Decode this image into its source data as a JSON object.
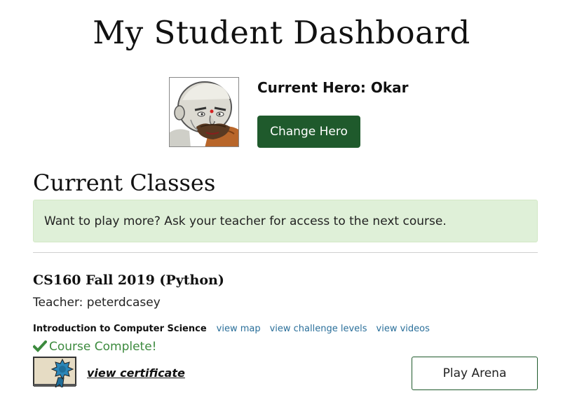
{
  "page": {
    "title": "My Student Dashboard"
  },
  "hero": {
    "label": "Current Hero: Okar",
    "change_button": "Change Hero",
    "portrait_icon": "bald-warrior-portrait"
  },
  "classes": {
    "heading": "Current Classes",
    "notice": "Want to play more? Ask your teacher for access to the next course.",
    "items": [
      {
        "name": "CS160 Fall 2019 (Python)",
        "teacher": "Teacher: peterdcasey",
        "course": {
          "title": "Introduction to Computer Science",
          "links": [
            "view map",
            "view challenge levels",
            "view videos"
          ],
          "status": "Course Complete!",
          "certificate_link": "view certificate"
        },
        "arena_button": "Play Arena"
      }
    ]
  },
  "colors": {
    "primary_button": "#1f5a2c",
    "alert_background": "#dff0d8",
    "link": "#2a6f9a",
    "success": "#3c8a3e"
  }
}
